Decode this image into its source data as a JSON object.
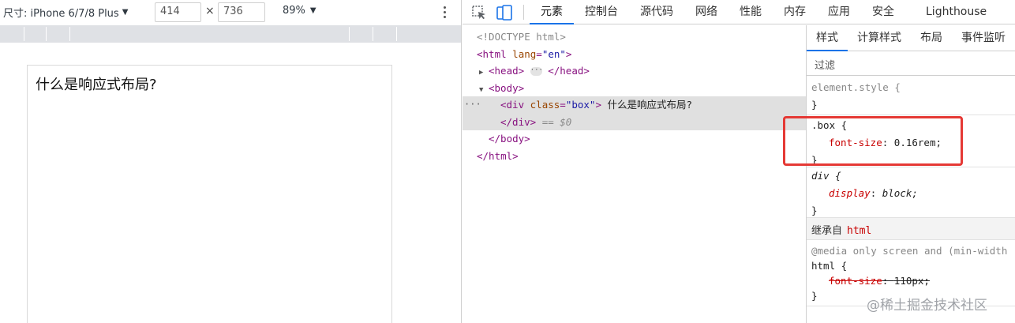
{
  "device_toolbar": {
    "device_label": "尺寸: iPhone 6/7/8 Plus",
    "width_value": "414",
    "height_value": "736",
    "times_symbol": "×",
    "zoom": "89%"
  },
  "viewport": {
    "box_text": "什么是响应式布局?"
  },
  "devtools_tabs": [
    "元素",
    "控制台",
    "源代码",
    "网络",
    "性能",
    "内存",
    "应用",
    "安全",
    "Lighthouse"
  ],
  "elements": {
    "doctype": "<!DOCTYPE html>",
    "html_open_tag": "<html",
    "html_attr_name": "lang",
    "html_attr_value": "\"en\"",
    "head_open": "<head>",
    "head_close": "</head>",
    "body_open": "<body>",
    "div_open_tag": "<div",
    "div_attr_name": "class",
    "div_attr_value": "\"box\"",
    "div_text": "什么是响应式布局?",
    "div_close": "</div>",
    "selected_marker": "== $0",
    "body_close": "</body>",
    "html_close": "</html>",
    "row_menu": "···",
    "collapsed_marker": "···"
  },
  "styles": {
    "tabs": [
      "样式",
      "计算样式",
      "布局",
      "事件监听"
    ],
    "filter_label": "过滤",
    "element_style_selector": "element.style {",
    "close_brace": "}",
    "box_selector": ".box {",
    "box_prop_name": "font-size",
    "box_prop_value": "0.16rem;",
    "div_selector": "div {",
    "div_prop_name": "display",
    "div_prop_value": "block;",
    "inherited_label": "继承自",
    "inherited_tag": "html",
    "media_query": "@media only screen and (min-width",
    "html_selector": "html {",
    "html_prop_name": "font-size",
    "html_prop_value": "110px;"
  },
  "watermark": "@稀土掘金技术社区",
  "colors": {
    "highlight_border": "#e53935",
    "active_tab_underline": "#1a73e8",
    "tag_color": "#881280",
    "property_color": "#c80000"
  }
}
